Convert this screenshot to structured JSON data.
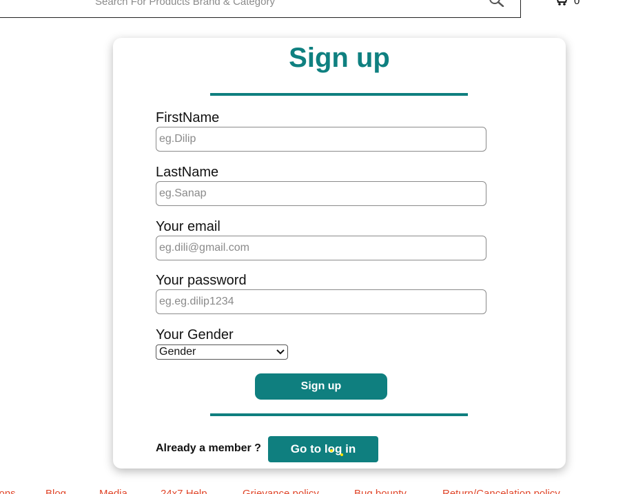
{
  "header": {
    "search_placeholder": "Search For Products Brand & Category",
    "cart_count": "0"
  },
  "form": {
    "title": "Sign up",
    "fields": [
      {
        "label": "FirstName",
        "placeholder": "eg.Dilip"
      },
      {
        "label": "LastName",
        "placeholder": "eg.Sanap"
      },
      {
        "label": "Your email",
        "placeholder": "eg.dili@gmail.com"
      },
      {
        "label": "Your password",
        "placeholder": "eg.eg.dilip1234"
      }
    ],
    "gender": {
      "label": "Your Gender",
      "selected": "Gender"
    },
    "submit_label": "Sign up",
    "member_text": "Already a member ?",
    "login_label": "Go to log in"
  },
  "footer": {
    "links": [
      "...ons",
      "Blog",
      "Media",
      "24x7 Help",
      "Grievance policy",
      "Bug bounty",
      "Return/Cancelation policy"
    ]
  },
  "colors": {
    "accent": "#0f7f7f",
    "footer_link": "#e0462a"
  }
}
